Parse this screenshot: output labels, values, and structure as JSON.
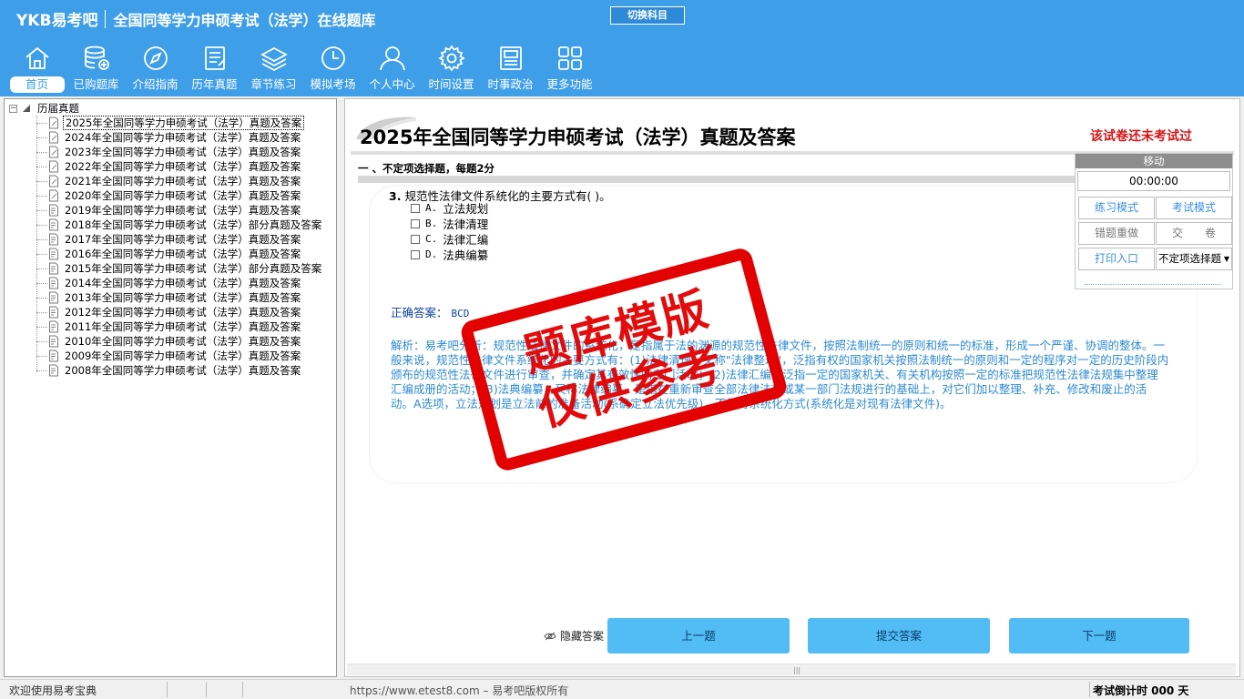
{
  "header": {
    "brand": "YKB易考吧",
    "title": "全国同等学力申硕考试（法学）在线题库",
    "switch_label": "切换科目",
    "nav": [
      {
        "label": "首页",
        "icon": "home-icon"
      },
      {
        "label": "已购题库",
        "icon": "database-add-icon"
      },
      {
        "label": "介绍指南",
        "icon": "compass-icon"
      },
      {
        "label": "历年真题",
        "icon": "list-doc-icon"
      },
      {
        "label": "章节练习",
        "icon": "layers-icon"
      },
      {
        "label": "模拟考场",
        "icon": "clock-icon"
      },
      {
        "label": "个人中心",
        "icon": "user-icon"
      },
      {
        "label": "时间设置",
        "icon": "gear-icon"
      },
      {
        "label": "时事政治",
        "icon": "newspaper-icon"
      },
      {
        "label": "更多功能",
        "icon": "grid-icon"
      }
    ]
  },
  "tree": {
    "root": "历届真题",
    "items": [
      "2025年全国同等学力申硕考试（法学）真题及答案",
      "2024年全国同等学力申硕考试（法学）真题及答案",
      "2023年全国同等学力申硕考试（法学）真题及答案",
      "2022年全国同等学力申硕考试（法学）真题及答案",
      "2021年全国同等学力申硕考试（法学）真题及答案",
      "2020年全国同等学力申硕考试（法学）真题及答案",
      "2019年全国同等学力申硕考试（法学）真题及答案",
      "2018年全国同等学力申硕考试（法学）部分真题及答案",
      "2017年全国同等学力申硕考试（法学）真题及答案",
      "2016年全国同等学力申硕考试（法学）真题及答案",
      "2015年全国同等学力申硕考试（法学）部分真题及答案",
      "2014年全国同等学力申硕考试（法学）真题及答案",
      "2013年全国同等学力申硕考试（法学）真题及答案",
      "2012年全国同等学力申硕考试（法学）真题及答案",
      "2011年全国同等学力申硕考试（法学）真题及答案",
      "2010年全国同等学力申硕考试（法学）真题及答案",
      "2009年全国同等学力申硕考试（法学）真题及答案",
      "2008年全国同等学力申硕考试（法学）真题及答案"
    ]
  },
  "paper": {
    "title": "2025年全国同等学力申硕考试（法学）真题及答案",
    "status": "该试卷还未考试过",
    "section": "一 、不定项选择题，每题2分",
    "question_no": "3.",
    "question": "规范性法律文件系统化的主要方式有( )。",
    "options": [
      {
        "key": "A.",
        "text": "立法规划"
      },
      {
        "key": "B.",
        "text": "法律清理"
      },
      {
        "key": "C.",
        "text": "法律汇编"
      },
      {
        "key": "D.",
        "text": "法典编纂"
      }
    ],
    "answer_label": "正确答案：",
    "answer_value": "BCD",
    "analysis": "解析：易考吧分析：规范性法律文件的系统化，是指属于法的渊源的规范性法律文件，按照法制统一的原则和统一的标准，形成一个严谨、协调的整体。一般来说，规范性法律文件系统化的主要方式有：(1)法律清理，又称\"法律整理\"，泛指有权的国家机关按照法制统一的原则和一定的程序对一定的历史阶段内颁布的规范性法律文件进行审查，并确定其有效性的专门活动；(2)法律汇编，泛指一定的国家机关、有关机构按照一定的标准把规范性法律法规集中整理汇编成册的活动；(3)法典编纂，又称法律编纂，是指在重新审查全部法律法规或某一部门法规进行的基础上，对它们加以整理、补充、修改和废止的活动。A选项，立法规划是立法前的准备活动(系确定立法优先级)，不是对系统化方式(系统化是对现有法律文件)。"
  },
  "controls": {
    "hide_answer": "隐藏答案",
    "prev": "上一题",
    "submit": "提交答案",
    "next": "下一题"
  },
  "panel": {
    "move": "移动",
    "timer": "00:00:00",
    "practice_mode": "练习模式",
    "exam_mode": "考试模式",
    "redo_wrong": "错题重做",
    "hand_in": "交　　卷",
    "print": "打印入口",
    "type_select": "不定项选择题"
  },
  "watermark": {
    "line1": "题库模版",
    "line2": "仅供参考"
  },
  "status": {
    "welcome": "欢迎使用易考宝典",
    "url": "https://www.etest8.com – 易考吧版权所有",
    "countdown": "考试倒计时 000 天"
  },
  "colors": {
    "header": "#3f9ee8",
    "stamp": "#e20000",
    "button": "#52bcf5",
    "analysis": "#2e8bd0"
  }
}
